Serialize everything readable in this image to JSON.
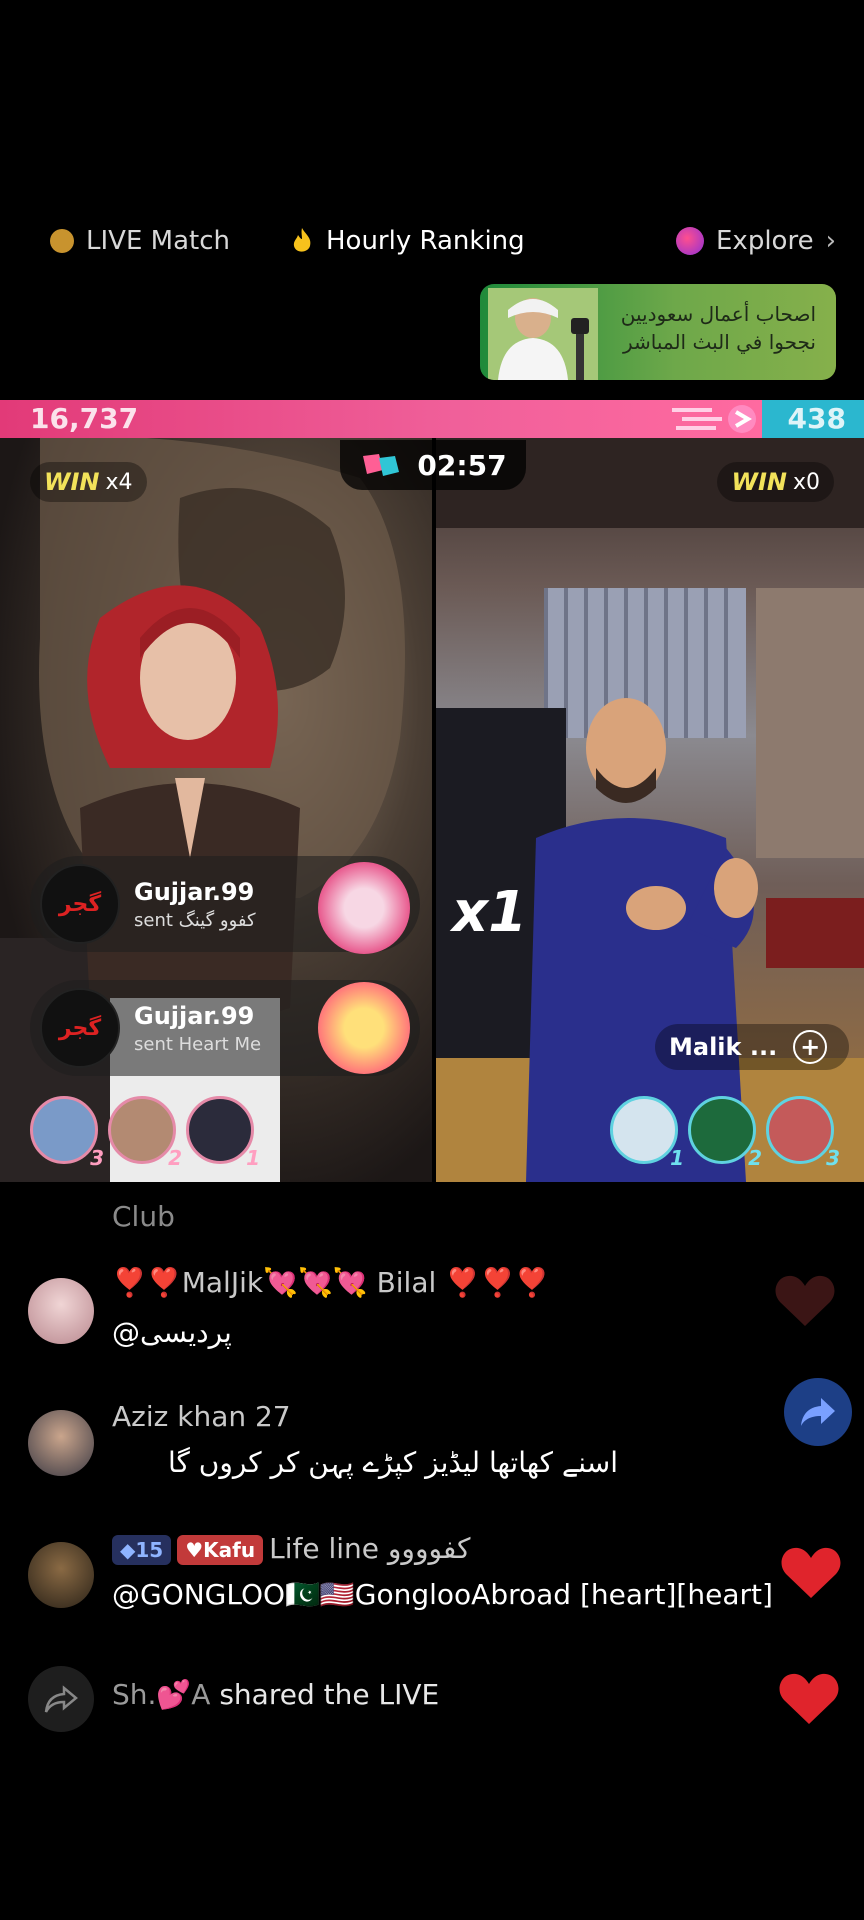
{
  "nav": {
    "live_match": "LIVE Match",
    "hourly_ranking": "Hourly Ranking",
    "explore": "Explore"
  },
  "banner": {
    "text": "اصحاب أعمال سعوديين نجحوا في البث المباشر"
  },
  "pk": {
    "left_score": "16,737",
    "right_score": "438",
    "timer": "02:57",
    "left_win_word": "WIN",
    "left_win_count": "x4",
    "right_win_word": "WIN",
    "right_win_count": "x0",
    "multiplier": "x1",
    "right_host_name": "Malik ..."
  },
  "gifts": [
    {
      "name": "Gujjar.99",
      "desc": "sent کفوو گینگ",
      "avatar_text": "گجر"
    },
    {
      "name": "Gujjar.99",
      "desc": "sent Heart Me",
      "avatar_text": "گجر"
    }
  ],
  "left_ranks": [
    "3",
    "2",
    "1"
  ],
  "right_ranks": [
    "1",
    "2",
    "3"
  ],
  "chat": {
    "club_label": "Club",
    "messages": [
      {
        "name": "❣️❣️MaاJik💘💘💘 Bilal ❣️❣️❣️",
        "text": "@پردیسی"
      },
      {
        "name": "Aziz khan 27",
        "text": "اسنے کھاتھا لیڈیز کپڑے پہن کر کروں گا"
      },
      {
        "level": "15",
        "fan_badge": "Kafu",
        "name": "Life line کفوووو",
        "text": "@GONGLOO🇵🇰🇺🇸GonglooAbroad [heart][heart]"
      }
    ],
    "share_user": "Sh.💕A",
    "share_text": "shared the LIVE"
  },
  "colors": {
    "left_bar": "#e23a78",
    "right_bar": "#2bb7cf",
    "win_yellow": "#f2e25a",
    "heart_red": "#e0242c"
  }
}
